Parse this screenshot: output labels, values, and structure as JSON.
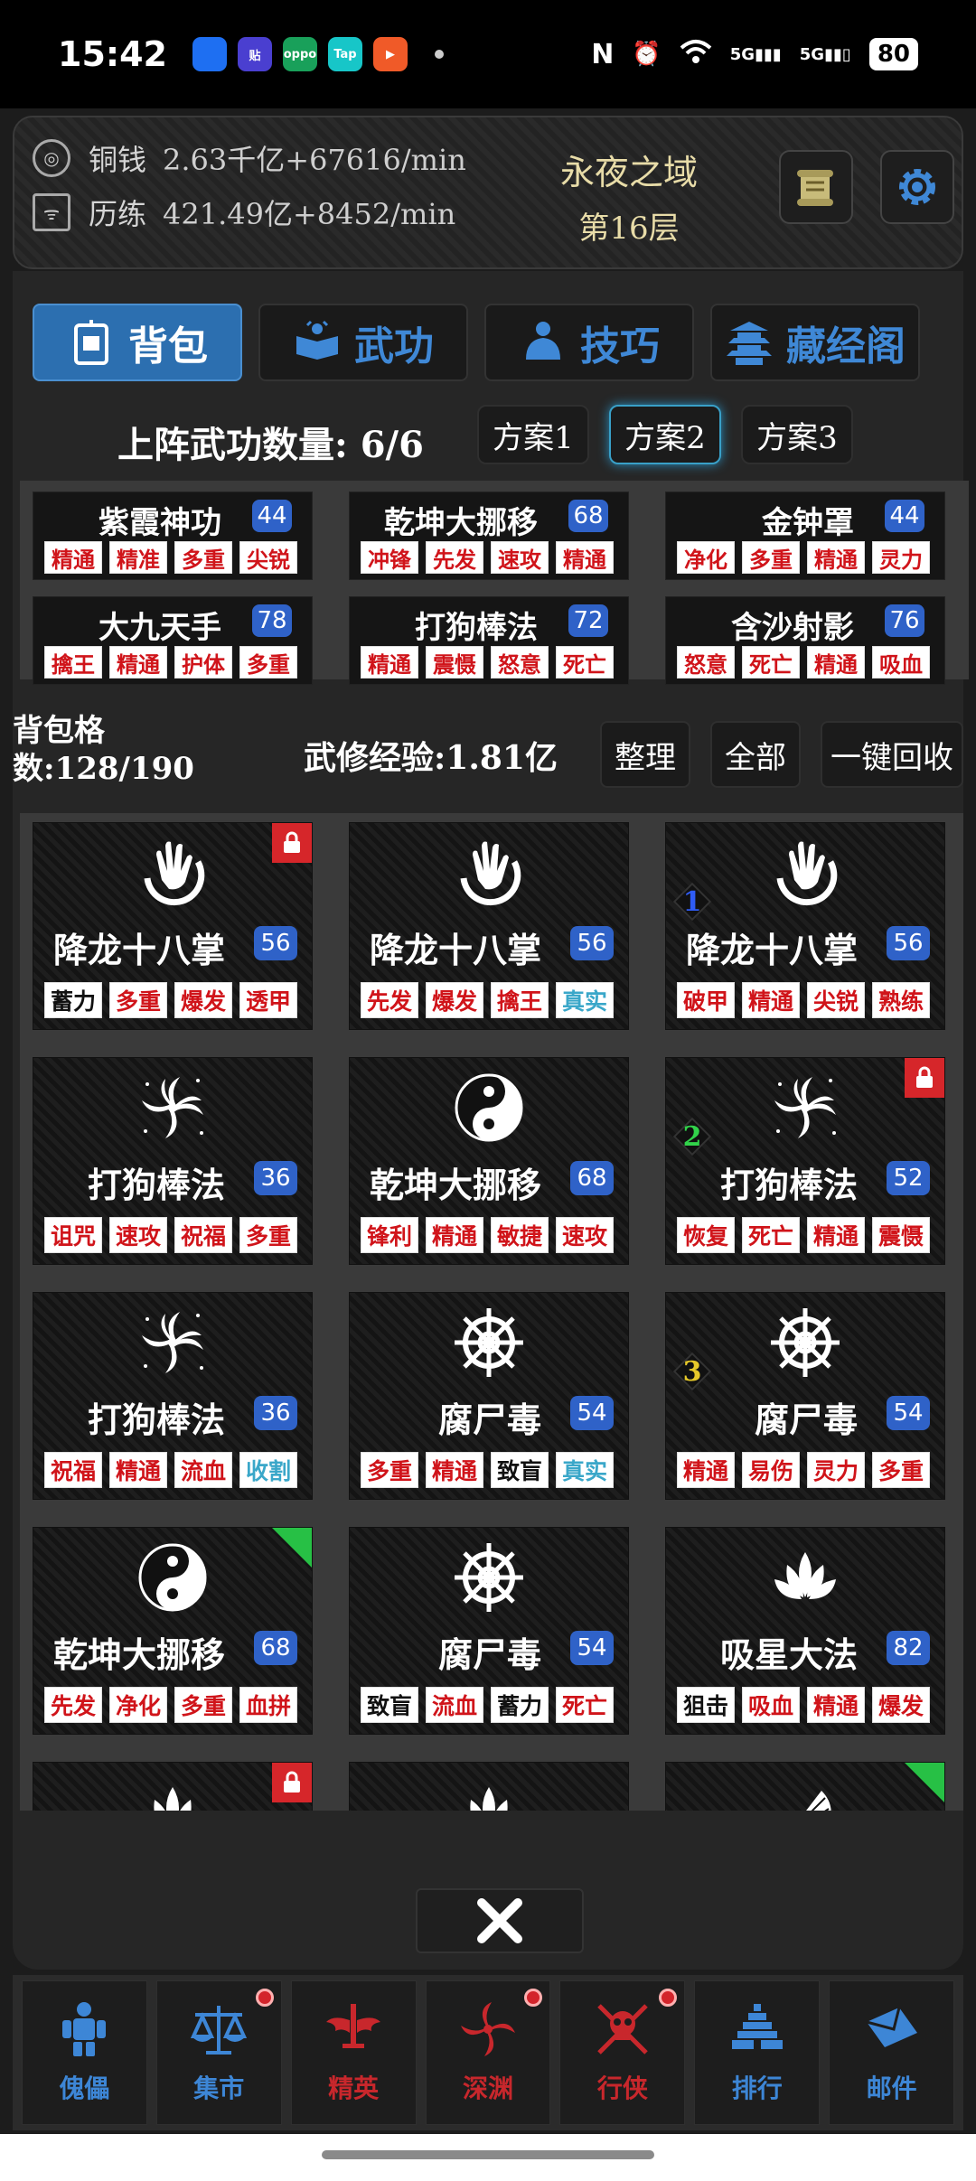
{
  "status_bar": {
    "time": "15:42",
    "apps": [
      {
        "name": "browser-app-icon",
        "color": "#1e6ff2",
        "label": ""
      },
      {
        "name": "tieba-app-icon",
        "color": "#4a3fd0",
        "label": "贴"
      },
      {
        "name": "oppo-app-icon",
        "color": "#19a05a",
        "label": "oppo"
      },
      {
        "name": "taptap-app-icon",
        "color": "#17c6c8",
        "label": "Tap"
      },
      {
        "name": "video-app-icon",
        "color": "#f05a28",
        "label": "▶"
      }
    ],
    "signal_labels": [
      "5G",
      "5G"
    ],
    "battery": "80"
  },
  "top": {
    "copper_label": "铜钱",
    "copper_value": "2.63千亿+67616/min",
    "exp_label": "历练",
    "exp_value": "421.49亿+8452/min",
    "realm_name": "永夜之域",
    "realm_floor": "第16层"
  },
  "tabs": [
    {
      "label": "背包",
      "icon": "backpack-icon",
      "active": true
    },
    {
      "label": "武功",
      "icon": "book-icon",
      "active": false
    },
    {
      "label": "技巧",
      "icon": "meditation-icon",
      "active": false
    },
    {
      "label": "藏经阁",
      "icon": "pagoda-icon",
      "active": false
    }
  ],
  "equip": {
    "header": "上阵武功数量: 6/6",
    "plans": [
      {
        "label": "方案1",
        "selected": false
      },
      {
        "label": "方案2",
        "selected": true
      },
      {
        "label": "方案3",
        "selected": false
      }
    ],
    "slots": [
      {
        "name": "紫霞神功",
        "level": "44",
        "tags": [
          "精通",
          "精准",
          "多重",
          "尖锐"
        ]
      },
      {
        "name": "乾坤大挪移",
        "level": "68",
        "tags": [
          "冲锋",
          "先发",
          "速攻",
          "精通"
        ]
      },
      {
        "name": "金钟罩",
        "level": "44",
        "tags": [
          "净化",
          "多重",
          "精通",
          "灵力"
        ]
      },
      {
        "name": "大九天手",
        "level": "78",
        "tags": [
          "擒王",
          "精通",
          "护体",
          "多重"
        ]
      },
      {
        "name": "打狗棒法",
        "level": "72",
        "tags": [
          "精通",
          "震慑",
          "怒意",
          "死亡"
        ]
      },
      {
        "name": "含沙射影",
        "level": "76",
        "tags": [
          "怒意",
          "死亡",
          "精通",
          "吸血"
        ]
      }
    ]
  },
  "bag": {
    "count_text": "背包格数:128/190",
    "exp_text": "武修经验:1.81亿",
    "sort_label": "整理",
    "all_label": "全部",
    "recycle_label": "一键回收"
  },
  "items": [
    {
      "name": "降龙十八掌",
      "level": "56",
      "icon": "palm-icon",
      "tags": [
        {
          "t": "蓄力",
          "c": "blk"
        },
        {
          "t": "多重",
          "c": "red"
        },
        {
          "t": "爆发",
          "c": "red"
        },
        {
          "t": "透甲",
          "c": "red"
        }
      ],
      "lock": true,
      "corner": false,
      "slot": ""
    },
    {
      "name": "降龙十八掌",
      "level": "56",
      "icon": "palm-icon",
      "tags": [
        {
          "t": "先发",
          "c": "red"
        },
        {
          "t": "爆发",
          "c": "red"
        },
        {
          "t": "擒王",
          "c": "red"
        },
        {
          "t": "真实",
          "c": "cyan"
        }
      ],
      "lock": false,
      "corner": false,
      "slot": ""
    },
    {
      "name": "降龙十八掌",
      "level": "56",
      "icon": "palm-icon",
      "tags": [
        {
          "t": "破甲",
          "c": "red"
        },
        {
          "t": "精通",
          "c": "red"
        },
        {
          "t": "尖锐",
          "c": "red"
        },
        {
          "t": "熟练",
          "c": "red"
        }
      ],
      "lock": false,
      "corner": false,
      "slot": "1",
      "slot_color": "#2f5cf5"
    },
    {
      "name": "打狗棒法",
      "level": "36",
      "icon": "vortex-icon",
      "tags": [
        {
          "t": "诅咒",
          "c": "red"
        },
        {
          "t": "速攻",
          "c": "red"
        },
        {
          "t": "祝福",
          "c": "red"
        },
        {
          "t": "多重",
          "c": "red"
        }
      ],
      "lock": false,
      "corner": false,
      "slot": ""
    },
    {
      "name": "乾坤大挪移",
      "level": "68",
      "icon": "yinyang-icon",
      "tags": [
        {
          "t": "锋利",
          "c": "red"
        },
        {
          "t": "精通",
          "c": "red"
        },
        {
          "t": "敏捷",
          "c": "red"
        },
        {
          "t": "速攻",
          "c": "red"
        }
      ],
      "lock": false,
      "corner": false,
      "slot": ""
    },
    {
      "name": "打狗棒法",
      "level": "52",
      "icon": "vortex-icon",
      "tags": [
        {
          "t": "恢复",
          "c": "red"
        },
        {
          "t": "死亡",
          "c": "red"
        },
        {
          "t": "精通",
          "c": "red"
        },
        {
          "t": "震慑",
          "c": "red"
        }
      ],
      "lock": true,
      "corner": false,
      "slot": "2",
      "slot_color": "#31d34a"
    },
    {
      "name": "打狗棒法",
      "level": "36",
      "icon": "vortex-icon",
      "tags": [
        {
          "t": "祝福",
          "c": "red"
        },
        {
          "t": "精通",
          "c": "red"
        },
        {
          "t": "流血",
          "c": "red"
        },
        {
          "t": "收割",
          "c": "cyan"
        }
      ],
      "lock": false,
      "corner": false,
      "slot": ""
    },
    {
      "name": "腐尸毒",
      "level": "54",
      "icon": "wheel-icon",
      "tags": [
        {
          "t": "多重",
          "c": "red"
        },
        {
          "t": "精通",
          "c": "red"
        },
        {
          "t": "致盲",
          "c": "blk"
        },
        {
          "t": "真实",
          "c": "cyan"
        }
      ],
      "lock": false,
      "corner": false,
      "slot": ""
    },
    {
      "name": "腐尸毒",
      "level": "54",
      "icon": "wheel-icon",
      "tags": [
        {
          "t": "精通",
          "c": "red"
        },
        {
          "t": "易伤",
          "c": "red"
        },
        {
          "t": "灵力",
          "c": "red"
        },
        {
          "t": "多重",
          "c": "red"
        }
      ],
      "lock": false,
      "corner": false,
      "slot": "3",
      "slot_color": "#e6c92a"
    },
    {
      "name": "乾坤大挪移",
      "level": "68",
      "icon": "yinyang-icon",
      "tags": [
        {
          "t": "先发",
          "c": "red"
        },
        {
          "t": "净化",
          "c": "red"
        },
        {
          "t": "多重",
          "c": "red"
        },
        {
          "t": "血拼",
          "c": "red"
        }
      ],
      "lock": false,
      "corner": true,
      "slot": ""
    },
    {
      "name": "腐尸毒",
      "level": "54",
      "icon": "wheel-icon",
      "tags": [
        {
          "t": "致盲",
          "c": "blk"
        },
        {
          "t": "流血",
          "c": "red"
        },
        {
          "t": "蓄力",
          "c": "blk"
        },
        {
          "t": "死亡",
          "c": "red"
        }
      ],
      "lock": false,
      "corner": false,
      "slot": ""
    },
    {
      "name": "吸星大法",
      "level": "82",
      "icon": "lotus-icon",
      "tags": [
        {
          "t": "狙击",
          "c": "blk"
        },
        {
          "t": "吸血",
          "c": "red"
        },
        {
          "t": "精通",
          "c": "red"
        },
        {
          "t": "爆发",
          "c": "red"
        }
      ],
      "lock": false,
      "corner": false,
      "slot": ""
    },
    {
      "name": "",
      "level": "",
      "icon": "lotus-icon",
      "tags": [],
      "lock": true,
      "corner": false,
      "slot": ""
    },
    {
      "name": "",
      "level": "",
      "icon": "lotus-icon",
      "tags": [],
      "lock": false,
      "corner": false,
      "slot": ""
    },
    {
      "name": "",
      "level": "",
      "icon": "fan-icon",
      "tags": [],
      "lock": false,
      "corner": true,
      "slot": ""
    }
  ],
  "bottom_nav": [
    {
      "label": "傀儡",
      "icon": "puppet-icon",
      "color": "#3d86d6",
      "dot": false
    },
    {
      "label": "集市",
      "icon": "scale-icon",
      "color": "#3d86d6",
      "dot": true
    },
    {
      "label": "精英",
      "icon": "winged-sword-icon",
      "color": "#c8272c",
      "dot": false
    },
    {
      "label": "深渊",
      "icon": "abyss-vortex-icon",
      "color": "#c8272c",
      "dot": true
    },
    {
      "label": "行侠",
      "icon": "skull-swords-icon",
      "color": "#c8272c",
      "dot": true
    },
    {
      "label": "排行",
      "icon": "pyramid-icon",
      "color": "#3d86d6",
      "dot": false
    },
    {
      "label": "邮件",
      "icon": "mail-icon",
      "color": "#3d86d6",
      "dot": false
    }
  ]
}
